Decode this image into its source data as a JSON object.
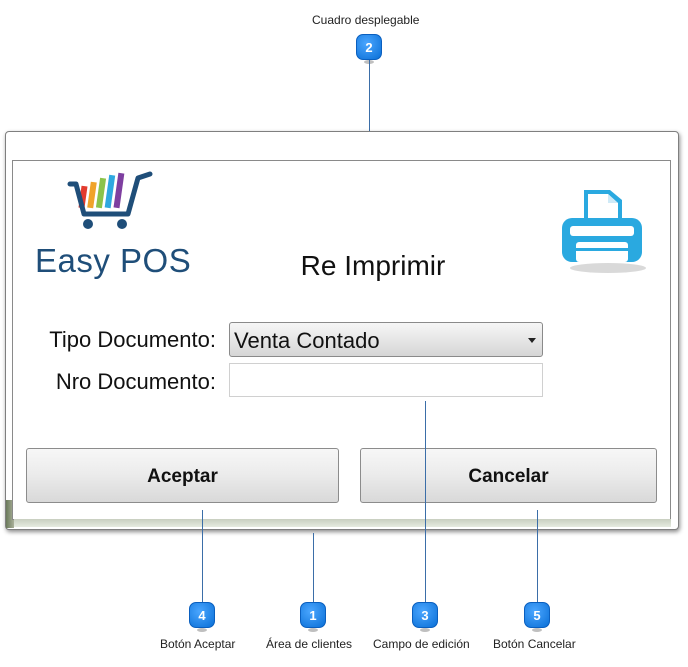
{
  "app": {
    "logo_text": "Easy POS",
    "title": "Re Imprimir"
  },
  "form": {
    "tipo_documento_label": "Tipo Documento:",
    "tipo_documento_value": "Venta Contado",
    "nro_documento_label": "Nro Documento:",
    "nro_documento_value": ""
  },
  "buttons": {
    "accept_label": "Aceptar",
    "cancel_label": "Cancelar"
  },
  "callouts": [
    {
      "number": "2",
      "label": "Cuadro desplegable"
    },
    {
      "number": "4",
      "label": "Botón Aceptar"
    },
    {
      "number": "1",
      "label": "Área de clientes"
    },
    {
      "number": "3",
      "label": "Campo de edición"
    },
    {
      "number": "5",
      "label": "Botón Cancelar"
    }
  ],
  "colors": {
    "callout_blue": "#0a6fd6",
    "logo_blue": "#1f4e79",
    "printer_blue": "#29a8e0"
  },
  "icons": {
    "logo": "shopping-cart-icon",
    "printer": "printer-icon"
  }
}
